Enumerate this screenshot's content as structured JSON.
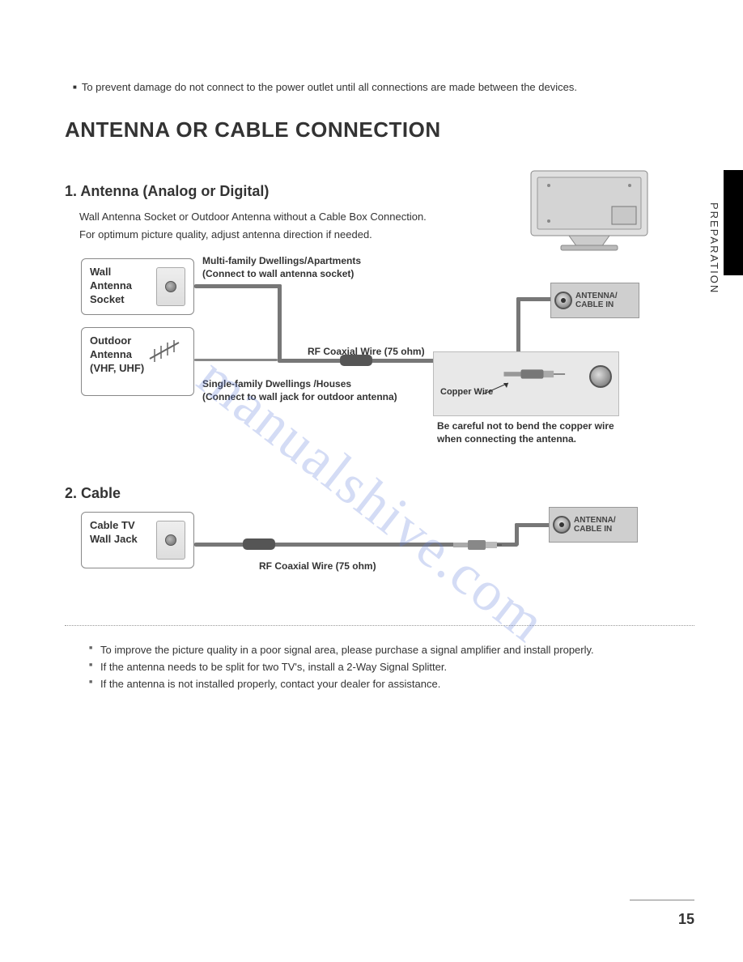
{
  "side_label": "PREPARATION",
  "top_note": "To prevent damage do not connect to the power outlet until all connections are made between the devices.",
  "main_title": "ANTENNA OR CABLE CONNECTION",
  "section1": {
    "heading": "1. Antenna (Analog or Digital)",
    "p1": "Wall Antenna Socket or Outdoor Antenna without a Cable Box Connection.",
    "p2": "For optimum picture quality, adjust antenna direction if needed.",
    "box_wall": "Wall\nAntenna\nSocket",
    "box_outdoor": "Outdoor\nAntenna\n(VHF, UHF)",
    "anno_multi": "Multi-family Dwellings/Apartments\n(Connect to wall antenna socket)",
    "anno_single": "Single-family Dwellings /Houses\n(Connect to wall jack for outdoor antenna)",
    "rf_label": "RF Coaxial Wire (75 ohm)",
    "port_label": "ANTENNA/\nCABLE IN",
    "copper_label": "Copper Wire",
    "copper_note": "Be careful not to bend the copper wire when connecting the antenna."
  },
  "section2": {
    "heading": "2. Cable",
    "box_cable": "Cable TV\nWall Jack",
    "rf_label": "RF Coaxial Wire (75 ohm)",
    "port_label": "ANTENNA/\nCABLE IN"
  },
  "notes": [
    "To improve the picture quality in a poor signal area, please purchase a signal amplifier and install properly.",
    "If the antenna needs to be split for two TV's, install a 2-Way Signal Splitter.",
    "If the antenna is not installed properly, contact your dealer for assistance."
  ],
  "watermark": "manualshive.com",
  "page_number": "15"
}
